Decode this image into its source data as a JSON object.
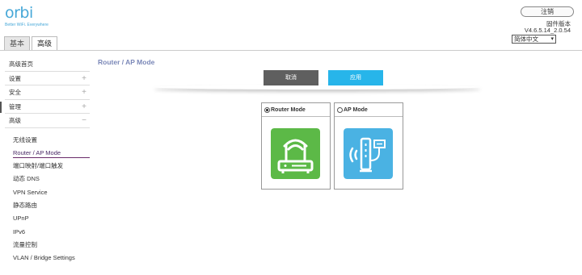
{
  "brand": {
    "logo_text": "orbi",
    "tagline": "Better WiFi. Everywhere"
  },
  "tabs": [
    {
      "label": "基本",
      "active": false
    },
    {
      "label": "高级",
      "active": true
    }
  ],
  "header": {
    "logout_label": "注销",
    "firmware_label": "固件版本",
    "firmware_version": "V4.6.5.14_2.0.54",
    "language": "简体中文"
  },
  "sidebar": {
    "items": [
      {
        "label": "高级首页",
        "expandable": false,
        "symbol": ""
      },
      {
        "label": "设置",
        "expandable": true,
        "symbol": "+"
      },
      {
        "label": "安全",
        "expandable": true,
        "symbol": "+"
      },
      {
        "label": "管理",
        "expandable": true,
        "symbol": "+"
      },
      {
        "label": "高级",
        "expandable": true,
        "symbol": "−"
      }
    ],
    "sub_items": [
      {
        "label": "无线设置"
      },
      {
        "label": "Router / AP Mode",
        "active": true
      },
      {
        "label": "端口映射/端口触发"
      },
      {
        "label": "动态 DNS"
      },
      {
        "label": "VPN Service"
      },
      {
        "label": "静态路由"
      },
      {
        "label": "UPnP"
      },
      {
        "label": "IPv6"
      },
      {
        "label": "流量控制"
      },
      {
        "label": "VLAN / Bridge Settings"
      }
    ]
  },
  "main": {
    "title": "Router / AP Mode",
    "cancel_label": "取消",
    "apply_label": "应用",
    "modes": [
      {
        "label": "Router Mode",
        "selected": true,
        "icon": "router-icon",
        "color": "#5cb947"
      },
      {
        "label": "AP Mode",
        "selected": false,
        "icon": "access-point-icon",
        "color": "#4ab2e3"
      }
    ]
  },
  "colors": {
    "accent": "#27b5ea",
    "cancel": "#5f5f5f",
    "title": "#7b88b8",
    "active_underline": "#6a2a6a"
  }
}
